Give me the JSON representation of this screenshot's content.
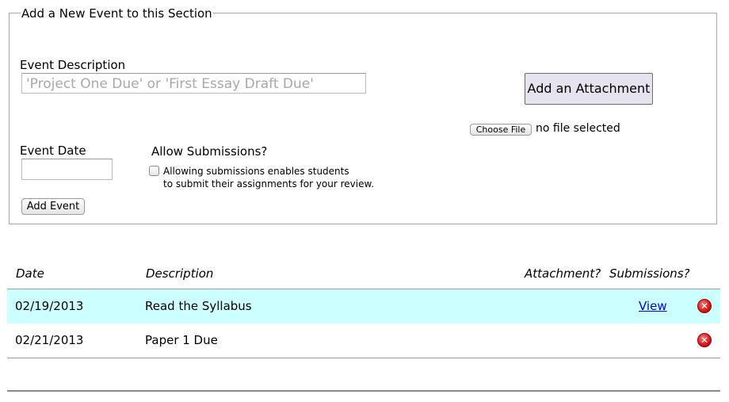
{
  "form": {
    "legend": "Add a New Event to this Section",
    "event_description_label": "Event Description",
    "event_description_placeholder": "'Project One Due' or 'First Essay Draft Due'",
    "event_description_value": "",
    "event_date_label": "Event Date",
    "event_date_value": "",
    "allow_submissions_label": "Allow Submissions?",
    "allow_submissions_help_line1": "Allowing submissions enables students",
    "allow_submissions_help_line2": "to submit their assignments for your review.",
    "allow_submissions_checked": false,
    "add_event_label": "Add Event",
    "add_attachment_label": "Add an Attachment",
    "choose_file_label": "Choose File",
    "no_file_text": "no file selected"
  },
  "table": {
    "headers": {
      "date": "Date",
      "description": "Description",
      "attachment": "Attachment?",
      "submissions": "Submissions?"
    },
    "rows": [
      {
        "date": "02/19/2013",
        "description": "Read the Syllabus",
        "submissions": "View",
        "highlighted": true
      },
      {
        "date": "02/21/2013",
        "description": "Paper 1 Due",
        "submissions": "",
        "highlighted": false
      }
    ]
  },
  "colors": {
    "highlight_row": "#ccffff",
    "attachment_button_bg": "#e6e2ee",
    "link": "#0000ee",
    "delete_icon": "#d41616"
  }
}
